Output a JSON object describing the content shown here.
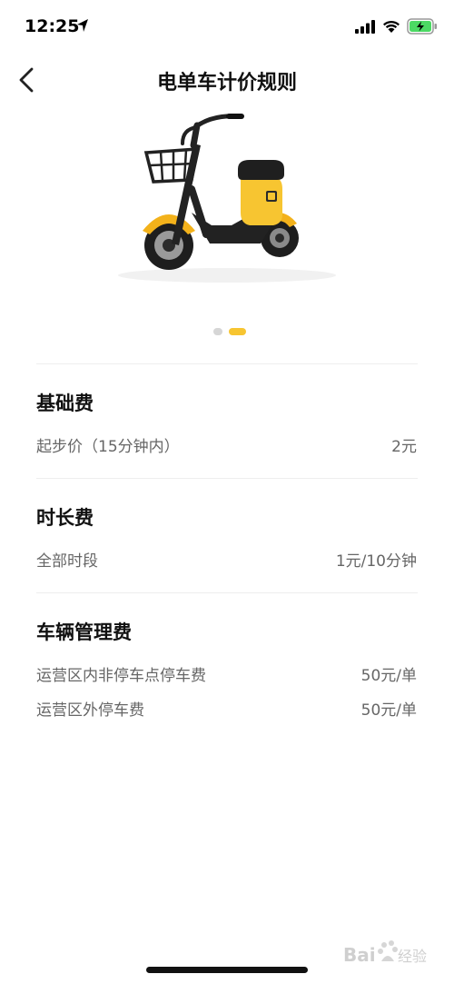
{
  "status_bar": {
    "time": "12:25"
  },
  "header": {
    "title": "电单车计价规则"
  },
  "carousel": {
    "total": 2,
    "active_index": 2
  },
  "sections": [
    {
      "title": "基础费",
      "rows": [
        {
          "label": "起步价（15分钟内）",
          "value": "2元"
        }
      ]
    },
    {
      "title": "时长费",
      "rows": [
        {
          "label": "全部时段",
          "value": "1元/10分钟"
        }
      ]
    },
    {
      "title": "车辆管理费",
      "rows": [
        {
          "label": "运营区内非停车点停车费",
          "value": "50元/单"
        },
        {
          "label": "运营区外停车费",
          "value": "50元/单"
        }
      ]
    }
  ],
  "watermark": {
    "text": "Bai经验"
  },
  "colors": {
    "accent": "#f7c531",
    "text": "#111111",
    "secondary_text": "#666666"
  }
}
